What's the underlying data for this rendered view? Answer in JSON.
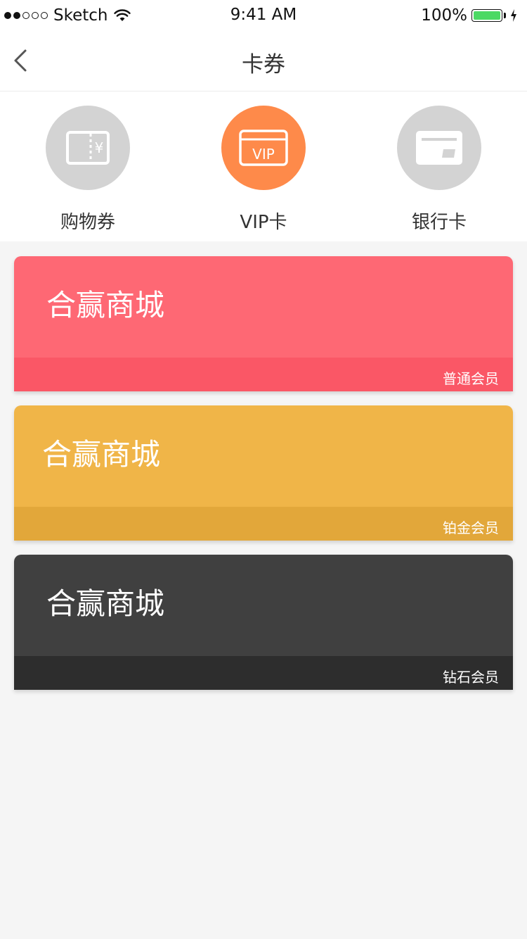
{
  "status_bar": {
    "carrier": "Sketch",
    "time": "9:41 AM",
    "battery": "100%"
  },
  "nav": {
    "title": "卡券",
    "back_icon": "chevron-left-icon"
  },
  "tabs": [
    {
      "label": "购物券",
      "icon": "coupon-icon",
      "active": false
    },
    {
      "label": "VIP卡",
      "icon": "vip-card-icon",
      "active": true,
      "icon_text": "VIP"
    },
    {
      "label": "银行卡",
      "icon": "bank-card-icon",
      "active": false
    }
  ],
  "cards": [
    {
      "name": "合赢商城",
      "tier": "普通会员",
      "color": "#fe6874",
      "footer_color": "#fa5766"
    },
    {
      "name": "合赢商城",
      "tier": "铂金会员",
      "color": "#f0b548",
      "footer_color": "#e2a73a"
    },
    {
      "name": "合赢商城",
      "tier": "钻石会员",
      "color": "#404040",
      "footer_color": "#2d2d2d"
    }
  ],
  "colors": {
    "accent": "#fe8a4a",
    "inactive_circle": "#d3d3d3",
    "background": "#f5f5f5"
  }
}
